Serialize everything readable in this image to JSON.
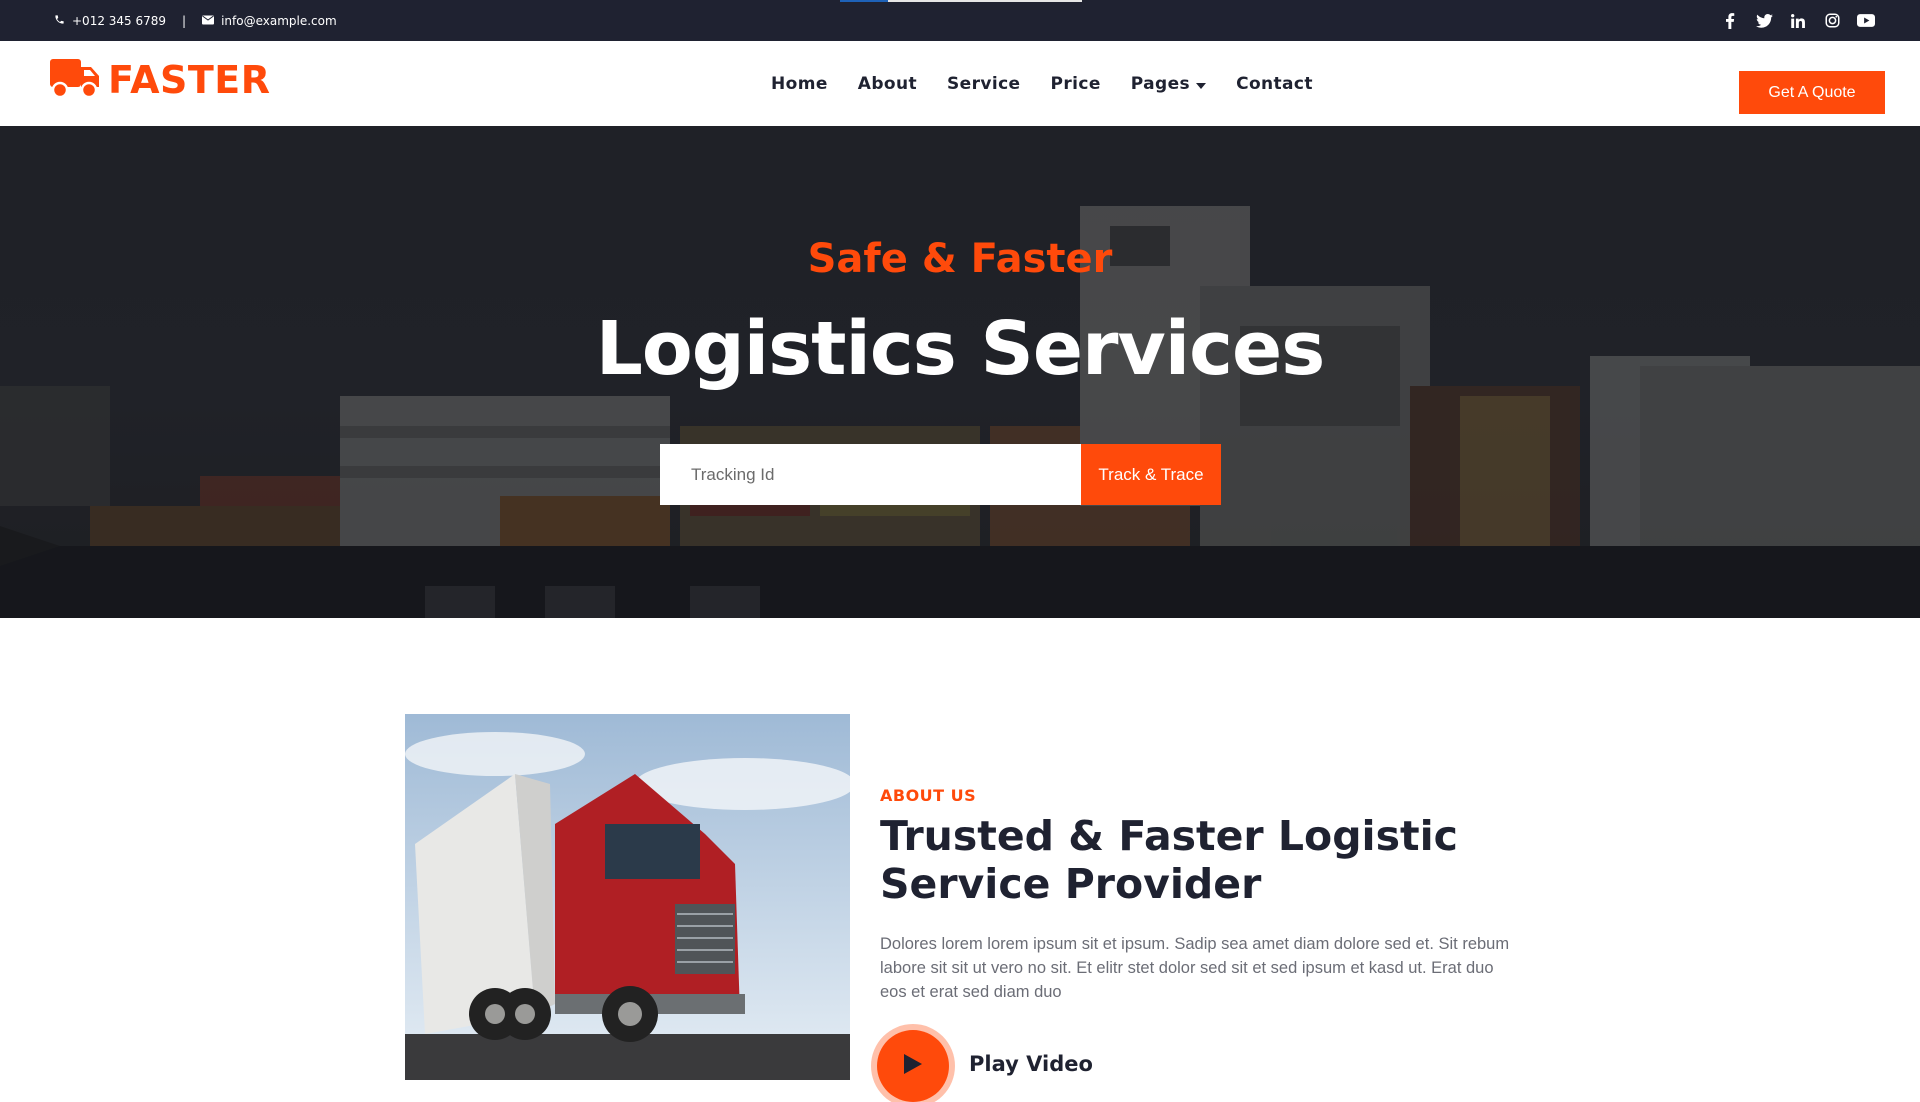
{
  "topbar": {
    "phone": "+012 345 6789",
    "separator": "|",
    "email": "info@example.com",
    "social_icons": [
      "facebook-icon",
      "twitter-icon",
      "linkedin-icon",
      "instagram-icon",
      "youtube-icon"
    ],
    "loading_progress": 0.2
  },
  "brand": {
    "name": "FASTER",
    "icon": "truck-icon"
  },
  "nav": {
    "items": [
      {
        "label": "Home"
      },
      {
        "label": "About"
      },
      {
        "label": "Service"
      },
      {
        "label": "Price"
      },
      {
        "label": "Pages",
        "has_dropdown": true
      },
      {
        "label": "Contact"
      }
    ],
    "quote_button": "Get A Quote"
  },
  "hero": {
    "subtitle": "Safe & Faster",
    "title": "Logistics Services",
    "tracking_placeholder": "Tracking Id",
    "track_button": "Track & Trace"
  },
  "about": {
    "label": "ABOUT US",
    "title": "Trusted & Faster Logistic Service Provider",
    "text": "Dolores lorem lorem ipsum sit et ipsum. Sadip sea amet diam dolore sed et. Sit rebum labore sit sit ut vero no sit. Et elitr stet dolor sed sit et sed ipsum et kasd ut. Erat duo eos et erat sed diam duo",
    "play_label": "Play Video"
  },
  "colors": {
    "accent": "#ff4a0b",
    "dark": "#1f2231",
    "white": "#ffffff"
  }
}
